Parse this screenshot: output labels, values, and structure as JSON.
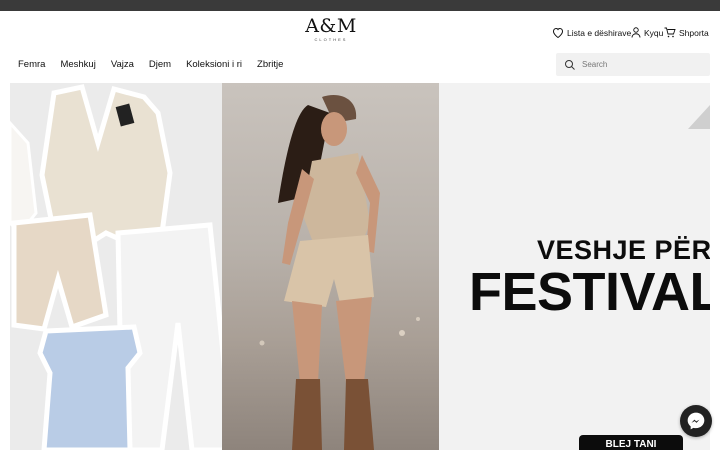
{
  "brand": {
    "logo": "A&M",
    "tagline": "CLOTHES"
  },
  "header": {
    "wishlist_label": "Lista e dëshirave",
    "login_label": "Kyqu",
    "cart_label": "Shporta"
  },
  "nav": {
    "items": [
      "Femra",
      "Meshkuj",
      "Vajza",
      "Djem",
      "Koleksioni i ri",
      "Zbritje"
    ]
  },
  "search": {
    "placeholder": "Search"
  },
  "hero": {
    "headline_line1": "VESHJE PËR",
    "headline_line2": "FESTIVAL",
    "button_label": "BLEJ TANI"
  },
  "colors": {
    "topbar": "#3a3a3a",
    "search_bg": "#f1f1f1",
    "button_bg": "#0c0c0c"
  },
  "icons": [
    "heart-icon",
    "user-icon",
    "cart-icon",
    "search-icon",
    "messenger-icon"
  ]
}
